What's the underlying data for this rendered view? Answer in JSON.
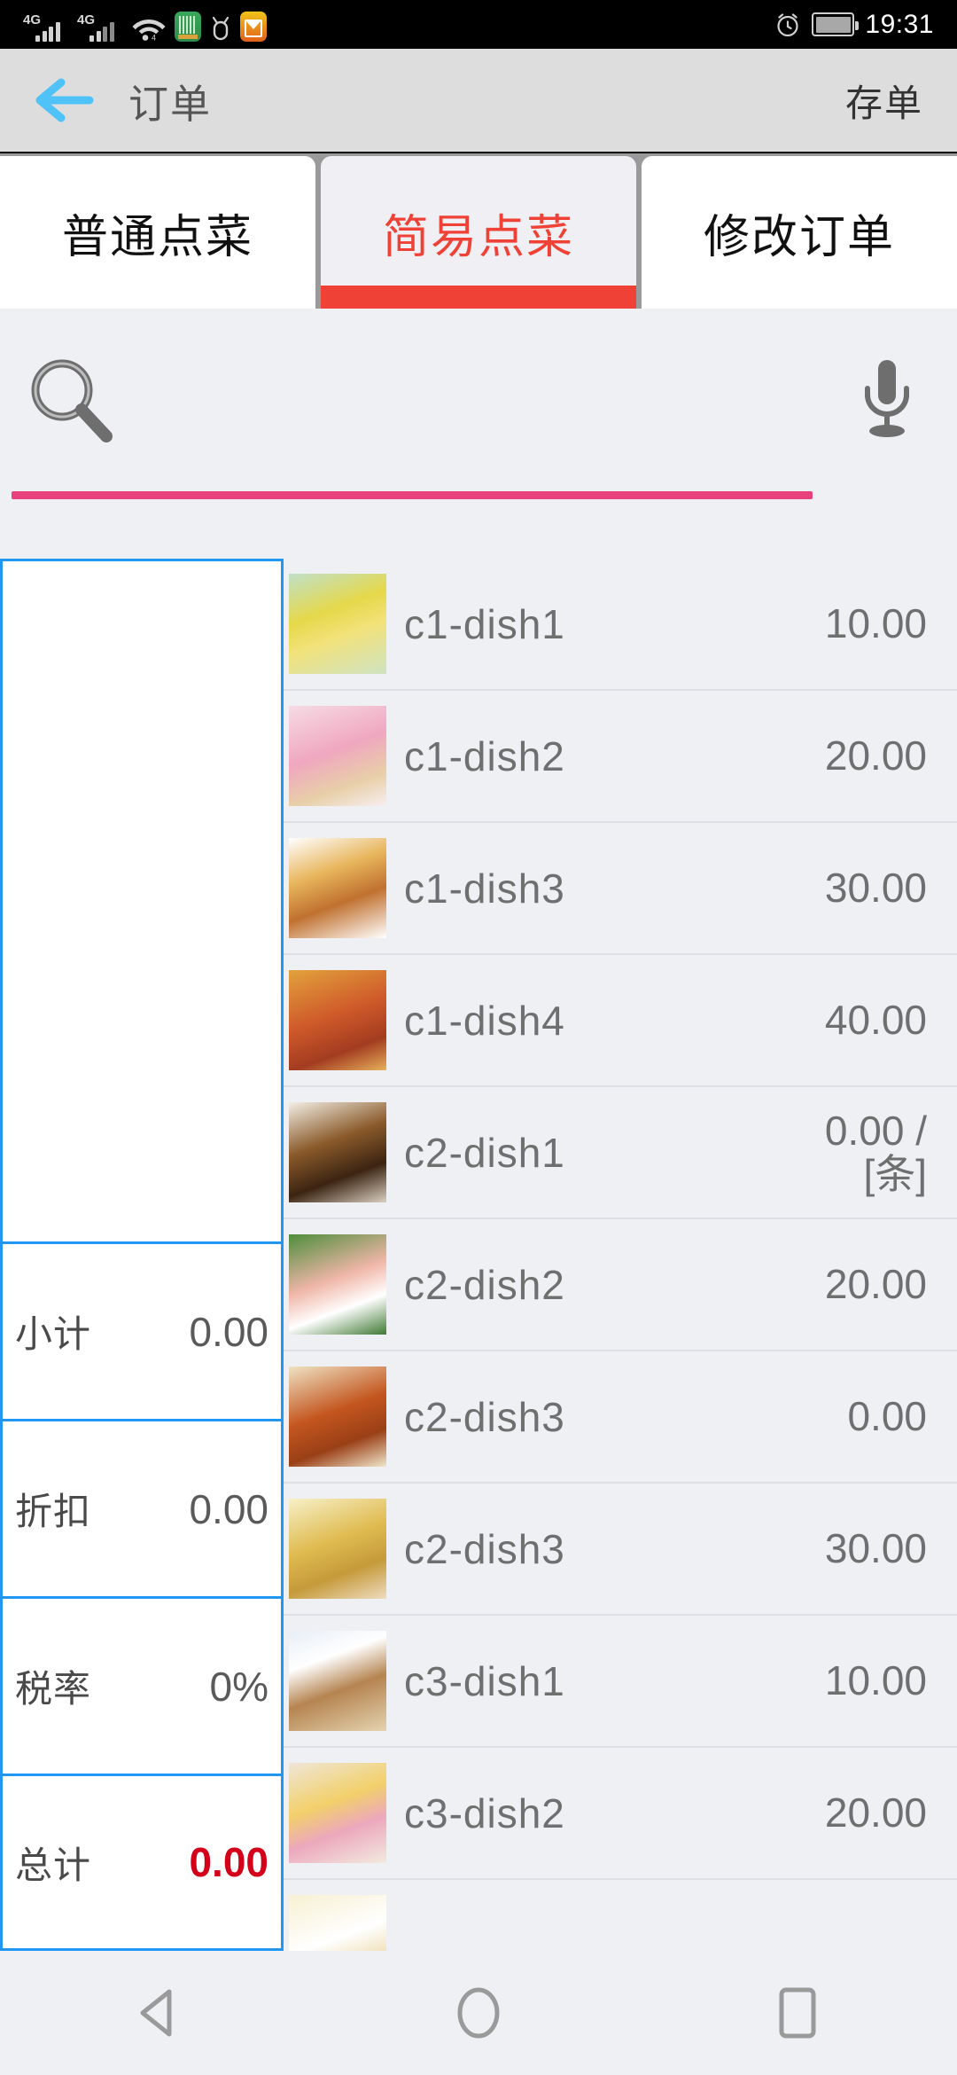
{
  "status_bar": {
    "network_left": "4G",
    "network_right": "4G",
    "clock": "19:31",
    "icons": [
      "signal-4g-icon",
      "signal-4g-icon",
      "wifi-icon",
      "app-green-icon",
      "bug-icon",
      "mail-icon",
      "alarm-icon",
      "battery-icon"
    ]
  },
  "app_bar": {
    "back_label": "←",
    "title": "订单",
    "action_label": "存单"
  },
  "tabs": [
    {
      "label": "普通点菜",
      "active": false
    },
    {
      "label": "简易点菜",
      "active": true
    },
    {
      "label": "修改订单",
      "active": false
    }
  ],
  "search": {
    "value": "",
    "placeholder": "",
    "magnifier_icon": "search-icon",
    "mic_icon": "microphone-icon",
    "underline_color": "#e8427c"
  },
  "order_summary": [
    {
      "label": "小计",
      "value": "0.00",
      "kind": "subtotal"
    },
    {
      "label": "折扣",
      "value": "0.00",
      "kind": "discount"
    },
    {
      "label": "税率",
      "value": "0%",
      "kind": "tax-rate"
    },
    {
      "label": "总计",
      "value": "0.00",
      "kind": "total"
    }
  ],
  "dish_list": [
    {
      "name": "c1-dish1",
      "price": "10.00",
      "thumb": "fruit-pudding-photo"
    },
    {
      "name": "c1-dish2",
      "price": "20.00",
      "thumb": "pink-cupcake-photo"
    },
    {
      "name": "c1-dish3",
      "price": "30.00",
      "thumb": "hamburger-photo"
    },
    {
      "name": "c1-dish4",
      "price": "40.00",
      "thumb": "pizza-photo"
    },
    {
      "name": "c2-dish1",
      "price": "0.00 /\n[条]",
      "thumb": "steamed-fish-photo"
    },
    {
      "name": "c2-dish2",
      "price": "20.00",
      "thumb": "shrimp-roll-photo"
    },
    {
      "name": "c2-dish3",
      "price": "0.00",
      "thumb": "clay-pot-soup-photo"
    },
    {
      "name": "c2-dish3",
      "price": "30.00",
      "thumb": "braised-chicken-photo"
    },
    {
      "name": "c3-dish1",
      "price": "10.00",
      "thumb": "milk-tea-bread-photo"
    },
    {
      "name": "c3-dish2",
      "price": "20.00",
      "thumb": "fruit-juice-photo"
    },
    {
      "name": "",
      "price": "",
      "thumb": "dessert-cup-photo"
    }
  ],
  "nav_bar": {
    "back_icon": "triangle-back-icon",
    "home_icon": "circle-home-icon",
    "recents_icon": "square-recents-icon"
  },
  "colors": {
    "accent_red": "#ef4136",
    "total_red": "#d4001a",
    "panel_border_blue": "#2196f3",
    "search_underline_pink": "#e8427c",
    "appbar_bg": "#dddddd",
    "list_bg": "#eef0f4"
  }
}
